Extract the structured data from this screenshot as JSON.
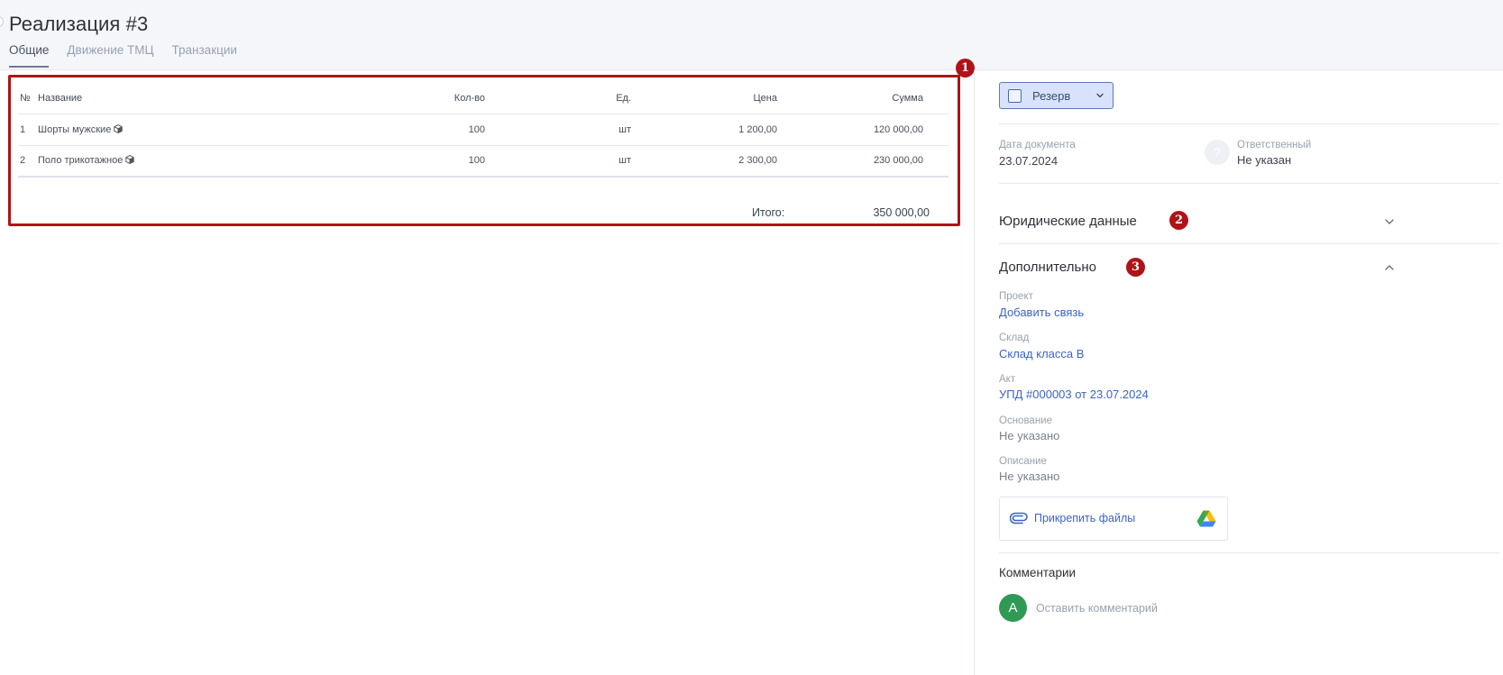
{
  "header": {
    "title": "Реализация #3",
    "tabs": [
      {
        "label": "Общие",
        "active": true
      },
      {
        "label": "Движение ТМЦ",
        "active": false
      },
      {
        "label": "Транзакции",
        "active": false
      }
    ]
  },
  "table": {
    "columns": {
      "num": "№",
      "name": "Название",
      "qty": "Кол-во",
      "unit": "Ед.",
      "price": "Цена",
      "sum": "Сумма"
    },
    "rows": [
      {
        "num": "1",
        "name": "Шорты мужские",
        "qty": "100",
        "unit": "шт",
        "price": "1 200,00",
        "sum": "120 000,00"
      },
      {
        "num": "2",
        "name": "Поло трикотажное",
        "qty": "100",
        "unit": "шт",
        "price": "2 300,00",
        "sum": "230 000,00"
      }
    ],
    "total_label": "Итого:",
    "total_value": "350 000,00"
  },
  "badges": {
    "b1": "1",
    "b2": "2",
    "b3": "3"
  },
  "right": {
    "reserve_label": "Резерв",
    "doc_date_label": "Дата документа",
    "doc_date_value": "23.07.2024",
    "responsible_label": "Ответственный",
    "responsible_value": "Не указан",
    "legal_title": "Юридические данные",
    "extra_title": "Дополнительно",
    "project_label": "Проект",
    "project_value": "Добавить связь",
    "warehouse_label": "Склад",
    "warehouse_value": "Склад класса В",
    "act_label": "Акт",
    "act_value": "УПД #000003 от 23.07.2024",
    "basis_label": "Основание",
    "basis_value": "Не указано",
    "description_label": "Описание",
    "description_value": "Не указано",
    "attach_label": "Прикрепить файлы",
    "comments_title": "Комментарии",
    "comment_avatar": "A",
    "comment_placeholder": "Оставить комментарий"
  },
  "colors": {
    "accent": "#3b63c4",
    "highlight_frame": "#b01317",
    "reserve_bg": "#d8e3fb",
    "avatar": "#2f9a55"
  },
  "icons": [
    "box-icon",
    "chevron-down-icon",
    "chevron-up-icon",
    "question-icon",
    "paperclip-icon",
    "google-drive-icon"
  ]
}
